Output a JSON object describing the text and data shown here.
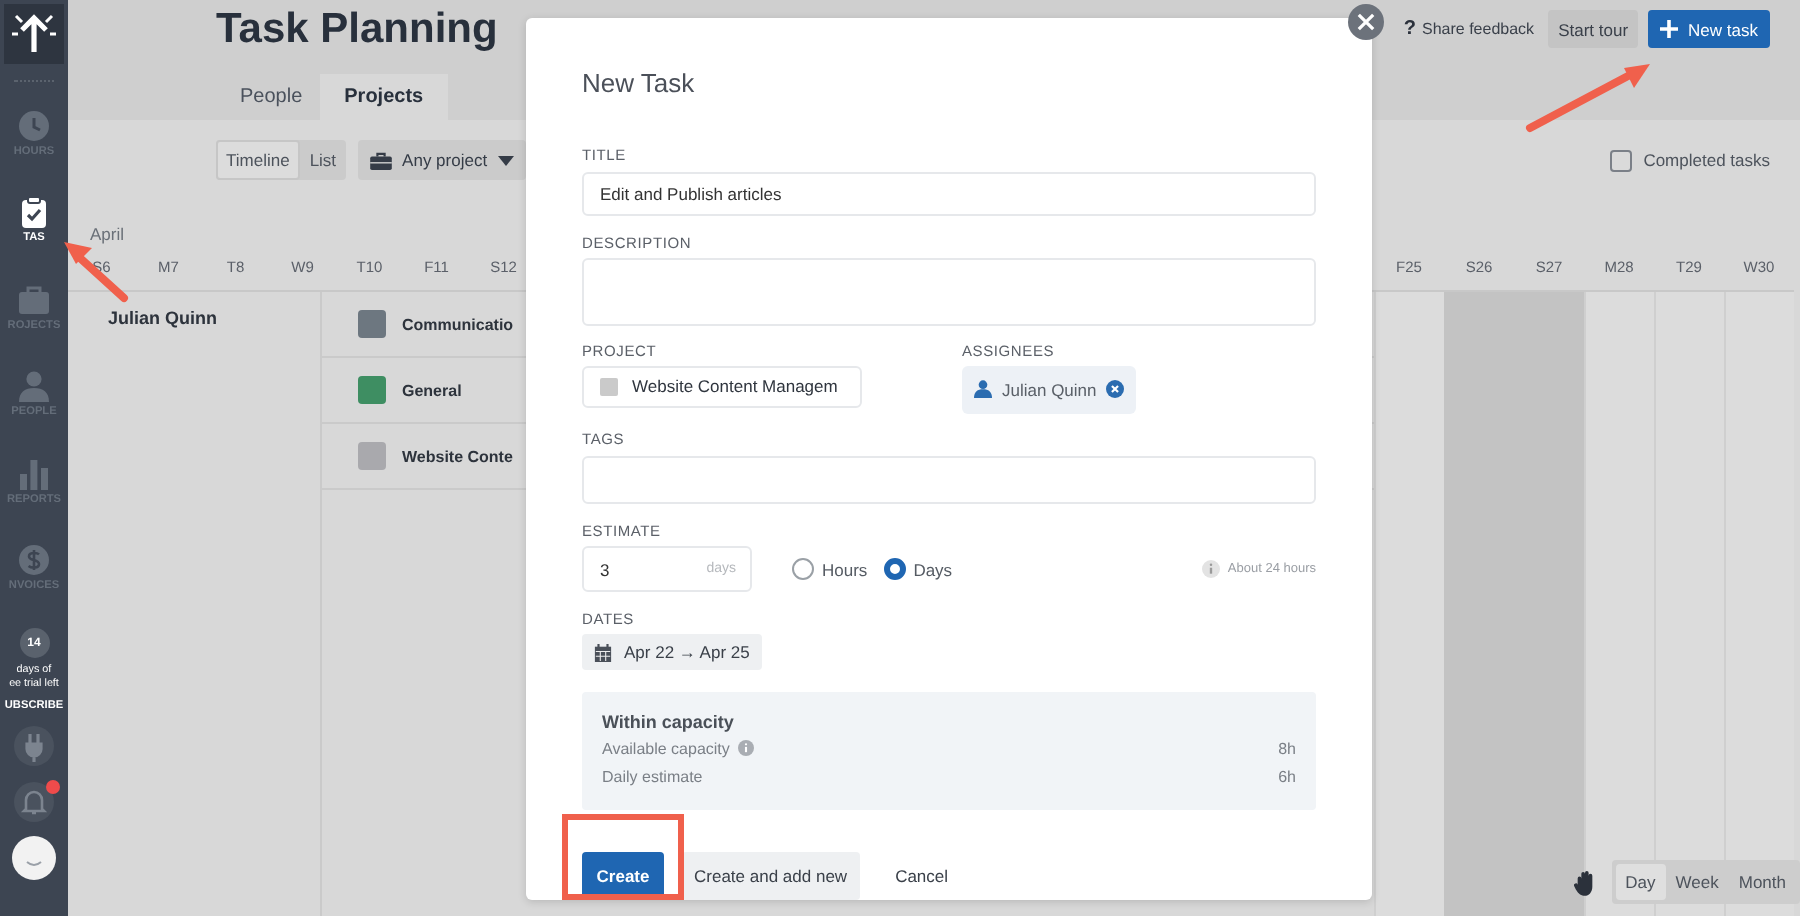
{
  "sidebar": {
    "items": [
      {
        "label": "HOURS",
        "selected": false
      },
      {
        "label": "TAS",
        "selected": true
      },
      {
        "label": "ROJECTS",
        "selected": false
      },
      {
        "label": "PEOPLE",
        "selected": false
      },
      {
        "label": "REPORTS",
        "selected": false
      },
      {
        "label": "NVOICES",
        "selected": false
      }
    ],
    "trial": {
      "count": "14",
      "lines": [
        "days of",
        "ee trial left"
      ],
      "action": "UBSCRIBE"
    },
    "notifications": {
      "unread": true
    }
  },
  "header": {
    "title": "Task Planning",
    "tabs": [
      {
        "label": "People",
        "selected": false
      },
      {
        "label": "Projects",
        "selected": true
      }
    ],
    "actions": [
      {
        "label": "Share feedback",
        "kind": "help",
        "icon": "?"
      },
      {
        "label": "Start tour",
        "kind": "secondary"
      },
      {
        "label": "New task",
        "kind": "primary"
      }
    ]
  },
  "toolbar": {
    "views": [
      {
        "label": "Timeline",
        "selected": true
      },
      {
        "label": "List",
        "selected": false
      }
    ],
    "project_filter": "Any project",
    "completed_tasks": {
      "label": "Completed tasks",
      "checked": false
    }
  },
  "calendar": {
    "month": "April",
    "days_left": [
      "S6",
      "M7",
      "T8",
      "W9",
      "T10",
      "F11",
      "S12"
    ],
    "days_right": [
      {
        "label": "F25",
        "weekend": false
      },
      {
        "label": "S26",
        "weekend": true
      },
      {
        "label": "S27",
        "weekend": true
      },
      {
        "label": "M28",
        "weekend": false
      },
      {
        "label": "T29",
        "weekend": false
      },
      {
        "label": "W30",
        "weekend": false
      }
    ],
    "person": "Julian Quinn",
    "projects": [
      {
        "name": "Communicatio",
        "color": "#6d7780"
      },
      {
        "name": "General",
        "color": "#3e8e62"
      },
      {
        "name": "Website Conte",
        "color": "#a9a9ad"
      }
    ],
    "view_modes": [
      {
        "label": "Day",
        "selected": true
      },
      {
        "label": "Week",
        "selected": false
      },
      {
        "label": "Month",
        "selected": false
      }
    ]
  },
  "modal": {
    "title": "New Task",
    "title_field": {
      "label": "TITLE",
      "value": "Edit and Publish articles"
    },
    "description": {
      "label": "DESCRIPTION"
    },
    "project": {
      "label": "PROJECT",
      "value": "Website Content Managem"
    },
    "assignees": {
      "label": "ASSIGNEES",
      "people": [
        "Julian Quinn"
      ]
    },
    "tags": {
      "label": "TAGS"
    },
    "estimate": {
      "label": "ESTIMATE",
      "value": "3",
      "unit": "days",
      "options": [
        {
          "label": "Hours",
          "selected": false
        },
        {
          "label": "Days",
          "selected": true
        }
      ],
      "hint": "About 24 hours"
    },
    "dates": {
      "label": "DATES",
      "range": "Apr 22 → Apr 25"
    },
    "capacity": {
      "title": "Within capacity",
      "rows": [
        {
          "label": "Available capacity",
          "info": true,
          "value": "8h"
        },
        {
          "label": "Daily estimate",
          "info": false,
          "value": "6h"
        }
      ]
    },
    "buttons": [
      {
        "label": "Create",
        "kind": "primary"
      },
      {
        "label": "Create and add new",
        "kind": "secondary"
      },
      {
        "label": "Cancel",
        "kind": "link"
      }
    ]
  }
}
